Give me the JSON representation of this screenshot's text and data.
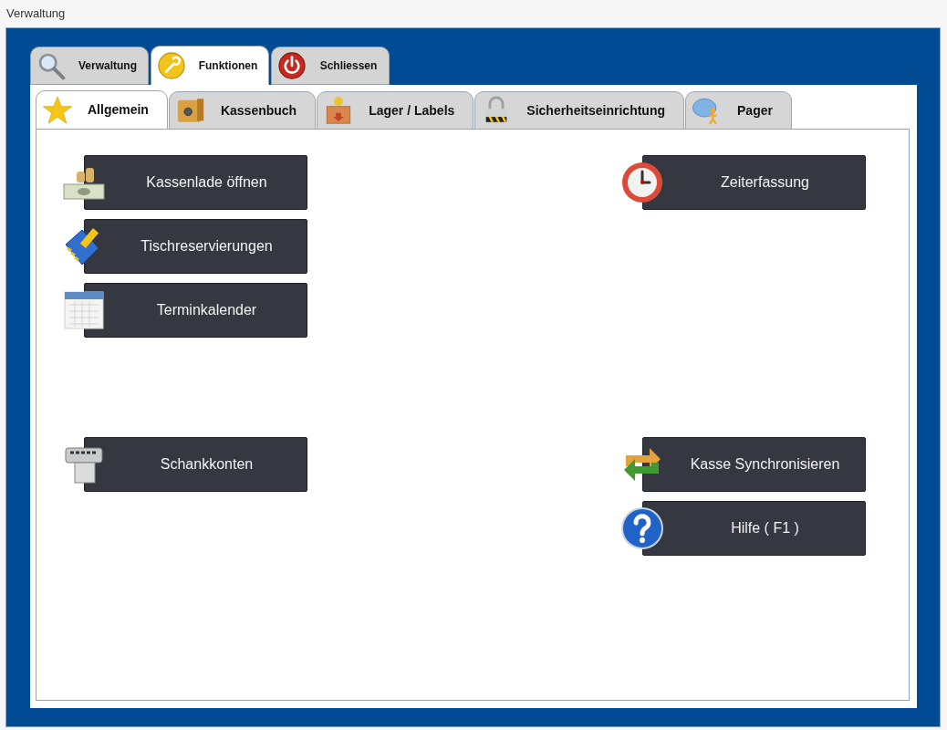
{
  "window": {
    "title": "Verwaltung"
  },
  "main_tabs": [
    {
      "label": "Verwaltung",
      "kind": "search",
      "selected": false
    },
    {
      "label": "Funktionen",
      "kind": "wrench",
      "selected": true
    },
    {
      "label": "Schliessen",
      "kind": "power",
      "selected": false
    }
  ],
  "sub_tabs": [
    {
      "label": "Allgemein",
      "kind": "star",
      "selected": true
    },
    {
      "label": "Kassenbuch",
      "kind": "safe",
      "selected": false
    },
    {
      "label": "Lager / Labels",
      "kind": "box",
      "selected": false
    },
    {
      "label": "Sicherheitseinrichtung",
      "kind": "lock",
      "selected": false
    },
    {
      "label": "Pager",
      "kind": "chat",
      "selected": false
    }
  ],
  "sections": [
    {
      "left": [
        {
          "label": "Kassenlade öffnen",
          "kind": "cash"
        },
        {
          "label": "Tischreservierungen",
          "kind": "book"
        },
        {
          "label": "Terminkalender",
          "kind": "calendar"
        }
      ],
      "right": [
        {
          "label": "Zeiterfassung",
          "kind": "clock"
        }
      ]
    },
    {
      "left": [
        {
          "label": "Schankkonten",
          "kind": "dispenser"
        }
      ],
      "right": [
        {
          "label": "Kasse Synchronisieren",
          "kind": "sync"
        },
        {
          "label": "Hilfe ( F1 )",
          "kind": "help"
        }
      ]
    }
  ]
}
